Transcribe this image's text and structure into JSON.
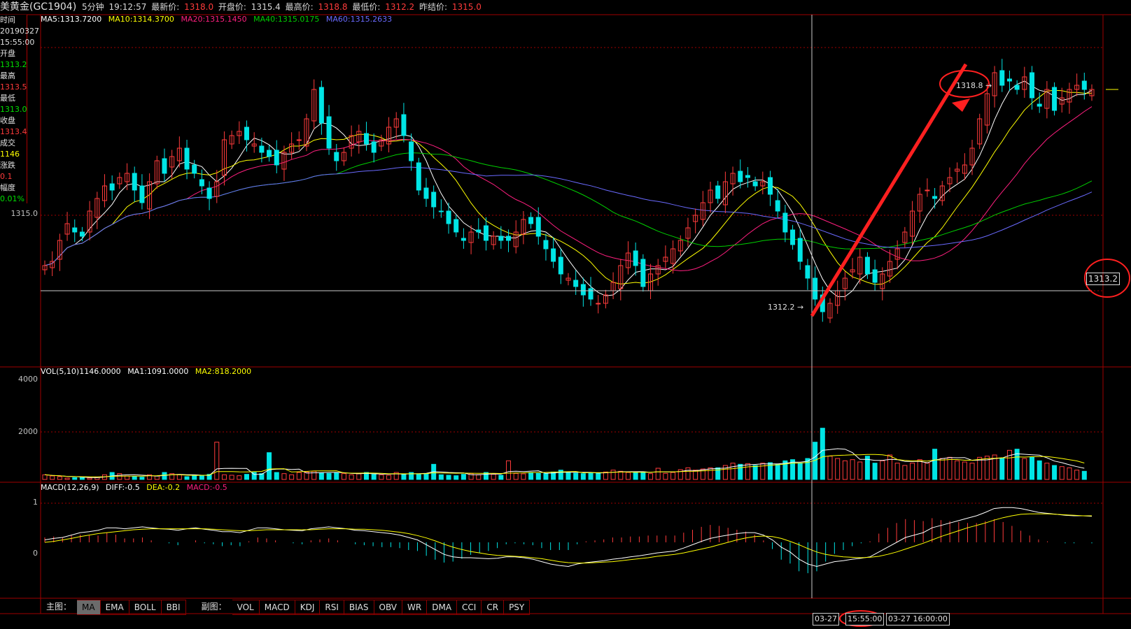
{
  "header": {
    "symbol": "美黄金(GC1904)",
    "period": "5分钟",
    "time": "19:12:57",
    "latest_label": "最新价:",
    "latest_value": "1318.0",
    "open_label": "开盘价:",
    "open_value": "1315.4",
    "high_label": "最高价:",
    "high_value": "1318.8",
    "low_label": "最低价:",
    "low_value": "1312.2",
    "prev_label": "昨结价:",
    "prev_value": "1315.0"
  },
  "info_panel": {
    "time_label": "时间",
    "date": "20190327",
    "time": "15:55:00",
    "open_label": "开盘",
    "open": "1313.2",
    "high_label": "最高",
    "high": "1313.5",
    "low_label": "最低",
    "low": "1313.0",
    "close_label": "收盘",
    "close": "1313.4",
    "volume_label": "成交",
    "volume": "1146",
    "change_label": "涨跌",
    "change": "0.1",
    "pct_label": "幅度",
    "pct": "0.01%"
  },
  "ma_legend": {
    "ma5": "MA5:1313.7200",
    "ma10": "MA10:1314.3700",
    "ma20": "MA20:1315.1450",
    "ma40": "MA40:1315.0175",
    "ma60": "MA60:1315.2633"
  },
  "vol_legend": {
    "vol": "VOL(5,10)1146.0000",
    "ma1": "MA1:1091.0000",
    "ma2": "MA2:818.2000"
  },
  "macd_legend": {
    "macd": "MACD(12,26,9)",
    "diff": "DIFF:-0.5",
    "dea": "DEA:-0.2",
    "macd_val": "MACD:-0.5"
  },
  "axis": {
    "price_label": "1315.0",
    "vol_4000": "4000",
    "vol_2000": "2000",
    "macd_1": "1",
    "macd_0": "0"
  },
  "annotations": {
    "high_marker": "1318.8",
    "low_marker": "1312.2",
    "crosshair_price": "1313.2"
  },
  "tabs": {
    "main_label": "主图：",
    "main": [
      "MA",
      "EMA",
      "BOLL",
      "BBI"
    ],
    "sub_label": "副图：",
    "sub": [
      "VOL",
      "MACD",
      "KDJ",
      "RSI",
      "BIAS",
      "OBV",
      "WR",
      "DMA",
      "CCI",
      "CR",
      "PSY"
    ]
  },
  "time_axis": {
    "left": "03-27",
    "cursor": "15:55:00",
    "right": "03-27 16:00:00"
  },
  "colors": {
    "up": "#ff3b3b",
    "down": "#00e5e5",
    "ma5": "#ffffff",
    "ma10": "#ffff00",
    "ma20": "#ff1f7f",
    "ma40": "#00d000",
    "ma60": "#6a6aff",
    "grid": "#a00000",
    "arrow": "#ff2020"
  },
  "chart_data": {
    "type": "candlestick",
    "title": "美黄金(GC1904) 5分钟",
    "price_range": [
      1311.5,
      1319.5
    ],
    "price_series": [
      1313.8,
      1313.9,
      1314.4,
      1314.8,
      1314.6,
      1314.5,
      1315.1,
      1315.4,
      1315.7,
      1315.6,
      1315.9,
      1316.0,
      1315.6,
      1315.3,
      1315.8,
      1316.3,
      1316.0,
      1316.4,
      1316.6,
      1316.1,
      1316.0,
      1315.7,
      1315.4,
      1315.8,
      1316.8,
      1316.9,
      1317.0,
      1316.8,
      1316.7,
      1316.5,
      1316.4,
      1316.2,
      1316.5,
      1316.7,
      1316.8,
      1317.3,
      1318.0,
      1317.2,
      1316.6,
      1316.3,
      1316.5,
      1316.9,
      1317.0,
      1316.7,
      1316.5,
      1316.8,
      1317.1,
      1317.3,
      1316.9,
      1316.3,
      1315.6,
      1315.4,
      1315.2,
      1315.1,
      1314.8,
      1314.6,
      1314.4,
      1314.6,
      1314.6,
      1314.4,
      1314.5,
      1314.4,
      1314.4,
      1314.6,
      1314.9,
      1314.8,
      1314.5,
      1314.2,
      1313.9,
      1313.6,
      1313.5,
      1313.3,
      1313.1,
      1313.0,
      1312.9,
      1313.1,
      1313.4,
      1313.8,
      1314.1,
      1313.8,
      1313.3,
      1313.6,
      1313.8,
      1314.0,
      1314.2,
      1314.4,
      1314.7,
      1315.0,
      1315.3,
      1315.6,
      1315.4,
      1315.8,
      1316.0,
      1315.8,
      1315.9,
      1315.7,
      1315.8,
      1315.5,
      1315.1,
      1314.6,
      1314.3,
      1313.9,
      1313.5,
      1313.0,
      1312.7,
      1312.9,
      1313.2,
      1313.5,
      1313.7,
      1314.0,
      1313.6,
      1313.4,
      1313.6,
      1313.9,
      1314.2,
      1314.6,
      1315.1,
      1315.5,
      1315.6,
      1315.4,
      1315.7,
      1315.9,
      1316.1,
      1316.2,
      1316.6,
      1317.3,
      1317.9,
      1318.4,
      1318.1,
      1318.2,
      1318.0,
      1318.3,
      1317.8,
      1317.6,
      1318.0,
      1317.5,
      1317.8,
      1318.0,
      1318.1,
      1318.0,
      1318.0
    ],
    "high": 1318.8,
    "low": 1312.2,
    "crosshair_price": 1313.2,
    "volume_range": [
      0,
      4500
    ],
    "volume_series": [
      200,
      150,
      120,
      60,
      80,
      100,
      60,
      90,
      200,
      300,
      250,
      150,
      120,
      100,
      200,
      150,
      300,
      250,
      200,
      120,
      150,
      180,
      220,
      1600,
      200,
      180,
      160,
      220,
      300,
      250,
      1150,
      300,
      250,
      200,
      300,
      320,
      350,
      280,
      260,
      300,
      250,
      200,
      240,
      300,
      220,
      200,
      180,
      300,
      240,
      300,
      220,
      250,
      650,
      200,
      180,
      160,
      220,
      250,
      200,
      300,
      220,
      180,
      800,
      260,
      240,
      300,
      260,
      260,
      320,
      400,
      300,
      270,
      250,
      300,
      280,
      320,
      400,
      350,
      300,
      300,
      320,
      250,
      480,
      260,
      300,
      420,
      500,
      400,
      450,
      500,
      500,
      600,
      700,
      650,
      680,
      600,
      700,
      720,
      650,
      800,
      850,
      700,
      900,
      1600,
      2200,
      1000,
      900,
      800,
      850,
      750,
      1000,
      700,
      800,
      1050,
      700,
      600,
      700,
      850,
      700,
      1300,
      900,
      950,
      800,
      750,
      700,
      950,
      1000,
      1050,
      900,
      1250,
      1300,
      900,
      950,
      800,
      700,
      600,
      550,
      500,
      400,
      350
    ],
    "macd_range": [
      -1.0,
      1.1
    ],
    "diff_series": [
      0.05,
      0.08,
      0.1,
      0.15,
      0.2,
      0.22,
      0.25,
      0.3,
      0.3,
      0.28,
      0.3,
      0.32,
      0.3,
      0.28,
      0.27,
      0.25,
      0.28,
      0.3,
      0.27,
      0.25,
      0.22,
      0.22,
      0.2,
      0.25,
      0.3,
      0.3,
      0.28,
      0.26,
      0.25,
      0.24,
      0.28,
      0.3,
      0.32,
      0.3,
      0.28,
      0.25,
      0.24,
      0.22,
      0.2,
      0.18,
      0.15,
      0.1,
      0.05,
      -0.05,
      -0.15,
      -0.25,
      -0.3,
      -0.32,
      -0.32,
      -0.33,
      -0.34,
      -0.33,
      -0.3,
      -0.3,
      -0.32,
      -0.35,
      -0.4,
      -0.45,
      -0.48,
      -0.5,
      -0.45,
      -0.42,
      -0.4,
      -0.38,
      -0.35,
      -0.33,
      -0.3,
      -0.28,
      -0.25,
      -0.22,
      -0.2,
      -0.18,
      -0.12,
      -0.05,
      0.02,
      0.08,
      0.12,
      0.15,
      0.18,
      0.2,
      0.2,
      0.15,
      0.05,
      -0.1,
      -0.2,
      -0.35,
      -0.45,
      -0.5,
      -0.45,
      -0.4,
      -0.38,
      -0.35,
      -0.33,
      -0.3,
      -0.2,
      -0.1,
      0.0,
      0.1,
      0.15,
      0.2,
      0.3,
      0.35,
      0.4,
      0.45,
      0.5,
      0.55,
      0.62,
      0.7,
      0.72,
      0.72,
      0.7,
      0.66,
      0.62,
      0.6,
      0.58,
      0.56,
      0.55,
      0.55,
      0.54
    ],
    "dea_series": [
      0.0,
      0.02,
      0.05,
      0.08,
      0.12,
      0.15,
      0.18,
      0.2,
      0.22,
      0.24,
      0.26,
      0.27,
      0.28,
      0.28,
      0.28,
      0.28,
      0.28,
      0.28,
      0.28,
      0.27,
      0.26,
      0.25,
      0.24,
      0.24,
      0.25,
      0.26,
      0.26,
      0.26,
      0.26,
      0.26,
      0.26,
      0.27,
      0.28,
      0.28,
      0.28,
      0.27,
      0.27,
      0.26,
      0.25,
      0.23,
      0.21,
      0.18,
      0.14,
      0.09,
      0.03,
      -0.04,
      -0.1,
      -0.15,
      -0.19,
      -0.22,
      -0.25,
      -0.27,
      -0.28,
      -0.29,
      -0.3,
      -0.32,
      -0.34,
      -0.37,
      -0.4,
      -0.42,
      -0.43,
      -0.43,
      -0.42,
      -0.41,
      -0.4,
      -0.38,
      -0.36,
      -0.34,
      -0.32,
      -0.29,
      -0.27,
      -0.25,
      -0.22,
      -0.18,
      -0.14,
      -0.1,
      -0.05,
      0.0,
      0.05,
      0.09,
      0.12,
      0.13,
      0.12,
      0.08,
      0.02,
      -0.05,
      -0.13,
      -0.2,
      -0.25,
      -0.28,
      -0.3,
      -0.31,
      -0.32,
      -0.31,
      -0.29,
      -0.25,
      -0.2,
      -0.14,
      -0.08,
      -0.02,
      0.05,
      0.12,
      0.18,
      0.24,
      0.3,
      0.35,
      0.4,
      0.46,
      0.51,
      0.55,
      0.58,
      0.59,
      0.59,
      0.59,
      0.58,
      0.57,
      0.56,
      0.55,
      0.55
    ]
  }
}
